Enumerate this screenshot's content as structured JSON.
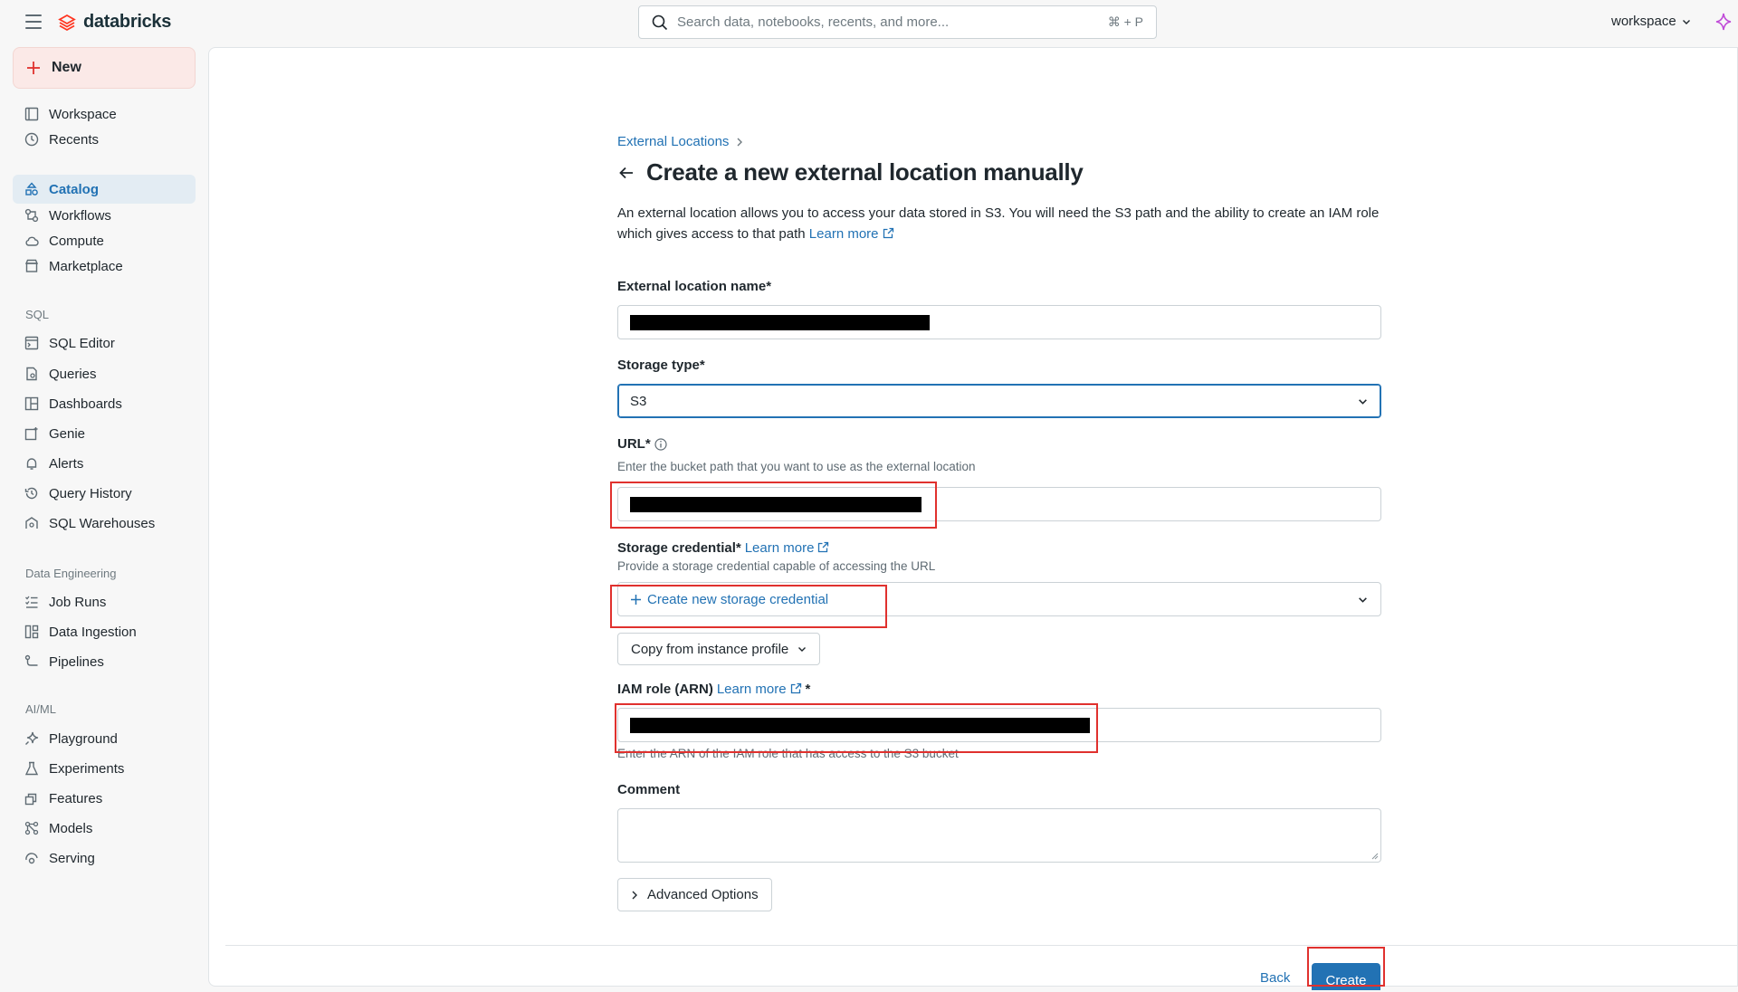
{
  "topbar": {
    "brand": "databricks",
    "search_placeholder": "Search data, notebooks, recents, and more...",
    "search_shortcut": "⌘ + P",
    "workspace_label": "workspace"
  },
  "sidebar": {
    "new_label": "New",
    "items": [
      {
        "label": "Workspace"
      },
      {
        "label": "Recents"
      },
      {
        "label": "Catalog"
      },
      {
        "label": "Workflows"
      },
      {
        "label": "Compute"
      },
      {
        "label": "Marketplace"
      }
    ],
    "sql_title": "SQL",
    "sql_items": [
      {
        "label": "SQL Editor"
      },
      {
        "label": "Queries"
      },
      {
        "label": "Dashboards"
      },
      {
        "label": "Genie"
      },
      {
        "label": "Alerts"
      },
      {
        "label": "Query History"
      },
      {
        "label": "SQL Warehouses"
      }
    ],
    "de_title": "Data Engineering",
    "de_items": [
      {
        "label": "Job Runs"
      },
      {
        "label": "Data Ingestion"
      },
      {
        "label": "Pipelines"
      }
    ],
    "ml_title": "AI/ML",
    "ml_items": [
      {
        "label": "Playground"
      },
      {
        "label": "Experiments"
      },
      {
        "label": "Features"
      },
      {
        "label": "Models"
      },
      {
        "label": "Serving"
      }
    ],
    "active_item": "Catalog"
  },
  "main": {
    "breadcrumb": "External Locations",
    "title": "Create a new external location manually",
    "description": "An external location allows you to access your data stored in S3. You will need the S3 path and the ability to create an IAM role which gives access to that path",
    "learn_more": "Learn more",
    "name_label": "External location name*",
    "storage_type_label": "Storage type*",
    "storage_type_value": "S3",
    "url_label": "URL*",
    "url_helper": "Enter the bucket path that you want to use as the external location",
    "credential_label": "Storage credential*",
    "credential_helper": "Provide a storage credential capable of accessing the URL",
    "credential_value": "Create new storage credential",
    "copy_profile_label": "Copy from instance profile",
    "iam_label": "IAM role (ARN)",
    "iam_required": "*",
    "iam_helper": "Enter the ARN of the IAM role that has access to the S3 bucket",
    "comment_label": "Comment",
    "advanced_label": "Advanced Options",
    "back_label": "Back",
    "create_label": "Create"
  },
  "colors": {
    "accent": "#2272b4",
    "brand": "#ff3621",
    "highlight_box": "#e0312e",
    "active_nav_bg": "#e3ecf3"
  }
}
